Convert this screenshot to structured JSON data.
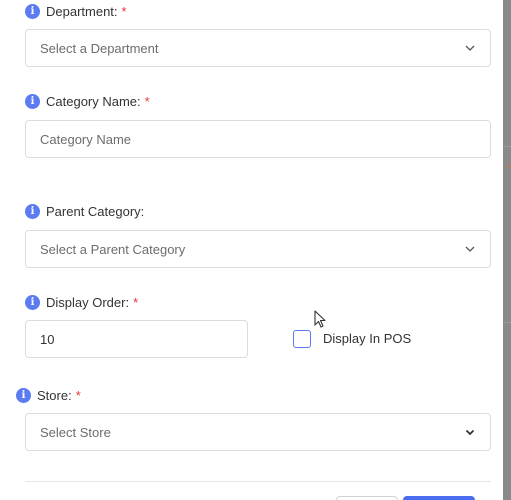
{
  "form": {
    "department": {
      "label": "Department:",
      "required": "*",
      "placeholder": "Select a Department"
    },
    "category_name": {
      "label": "Category Name:",
      "required": "*",
      "placeholder": "Category Name"
    },
    "parent_category": {
      "label": "Parent Category:",
      "placeholder": "Select a Parent Category"
    },
    "display_order": {
      "label": "Display Order:",
      "required": "*",
      "value": "10"
    },
    "display_in_pos": {
      "label": "Display In POS",
      "checked": false
    },
    "store": {
      "label": "Store:",
      "required": "*",
      "placeholder": "Select Store"
    }
  },
  "colors": {
    "accent": "#5b7bf0",
    "required": "#e53935",
    "border": "#d9dde2"
  },
  "icons": {
    "info": "info-icon",
    "dropdown": "chevron-down-icon"
  }
}
